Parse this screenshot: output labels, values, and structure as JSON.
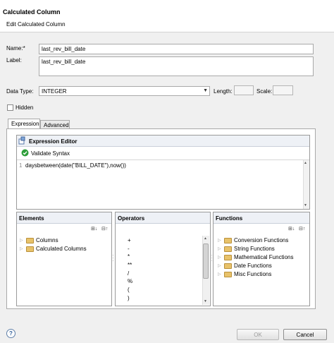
{
  "dialog": {
    "title": "Calculated Column",
    "subtitle": "Edit Calculated Column"
  },
  "form": {
    "name_label": "Name:*",
    "name_value": "last_rev_bill_date",
    "label_label": "Label:",
    "label_value": "last_rev_bill_date",
    "data_type_label": "Data Type:",
    "data_type_value": "INTEGER",
    "length_label": "Length:",
    "scale_label": "Scale:",
    "hidden_label": "Hidden"
  },
  "tabs": [
    {
      "label": "Expression"
    },
    {
      "label": "Advanced"
    }
  ],
  "editor": {
    "title": "Expression Editor",
    "validate_label": "Validate Syntax",
    "line_number": "1",
    "expression": "daysbetween(date(\"BILL_DATE\"),now())"
  },
  "elements": {
    "title": "Elements",
    "items": [
      {
        "label": "Columns"
      },
      {
        "label": "Calculated Columns"
      }
    ]
  },
  "operators": {
    "title": "Operators",
    "items": [
      "+",
      "-",
      "*",
      "**",
      "/",
      "%",
      "(",
      ")"
    ]
  },
  "functions": {
    "title": "Functions",
    "items": [
      {
        "label": "Conversion Functions"
      },
      {
        "label": "String Functions"
      },
      {
        "label": "Mathematical Functions"
      },
      {
        "label": "Date Functions"
      },
      {
        "label": "Misc Functions"
      }
    ]
  },
  "footer": {
    "help_icon": "?",
    "ok_label": "OK",
    "cancel_label": "Cancel"
  },
  "colors": {
    "validate_icon": "#2e9e3a",
    "folder": "#e8c26a"
  }
}
